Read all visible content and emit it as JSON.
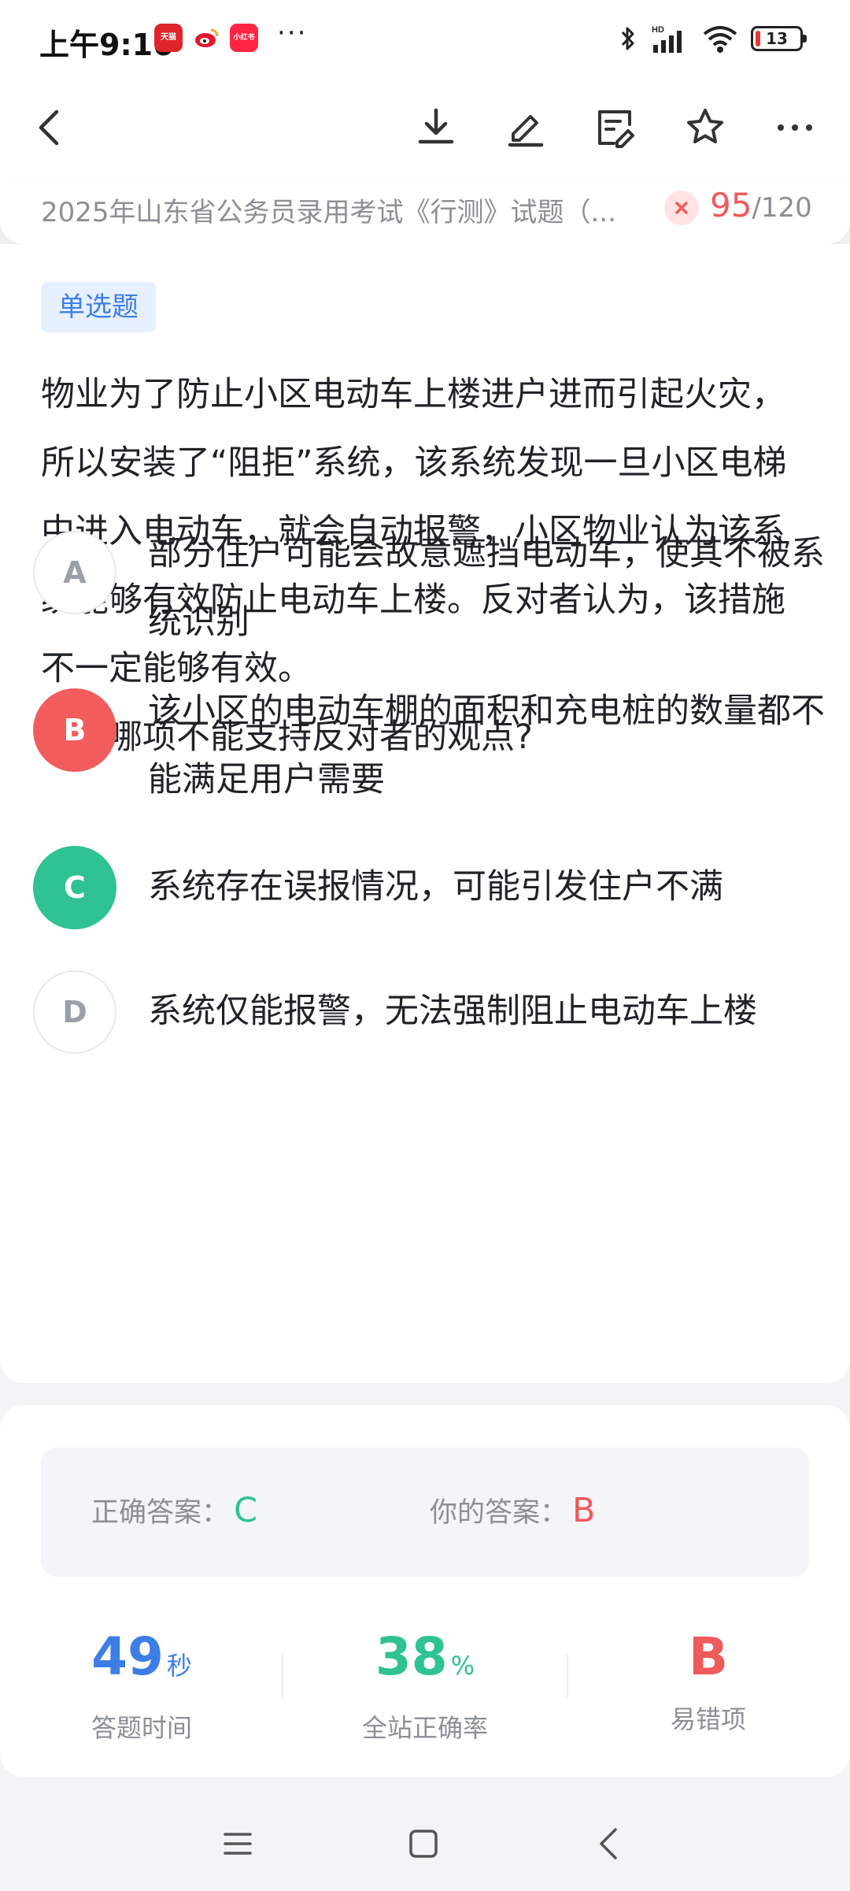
{
  "status_bar": {
    "time": "上午9:16",
    "app_badges": [
      {
        "name": "tmall",
        "text": "天猫",
        "color": "#e0242c"
      },
      {
        "name": "weibo",
        "text": "",
        "color": "#f5c518"
      },
      {
        "name": "xiaohongshu",
        "text": "小红书",
        "color": "#ff2442"
      }
    ],
    "more": "···",
    "battery_level": "13"
  },
  "toolbar": {
    "back": "back",
    "icons": [
      "download-icon",
      "edit-icon",
      "note-icon",
      "star-icon",
      "more-icon"
    ]
  },
  "exam": {
    "title": "2025年山东省公务员录用考试《行测》试题（...",
    "current": "95",
    "total": "/120",
    "status_color": "#ef5a5a"
  },
  "question": {
    "type_label": "单选题",
    "stem": "物业为了防止小区电动车上楼进户进而引起火灾，所以安装了“阻拒”系统，该系统发现一旦小区电梯中进入电动车，就会自动报警，小区物业认为该系统能够有效防止电动车上楼。反对者认为，该措施不一定能够有效。",
    "prompt": "以下哪项不能支持反对者的观点?",
    "options": [
      {
        "letter": "A",
        "text": "部分住户可能会故意遮挡电动车，使其不被系统识别",
        "state": "normal"
      },
      {
        "letter": "B",
        "text": "该小区的电动车棚的面积和充电桩的数量都不能满足用户需要",
        "state": "wrong"
      },
      {
        "letter": "C",
        "text": "系统存在误报情况，可能引发住户不满",
        "state": "correct"
      },
      {
        "letter": "D",
        "text": "系统仅能报警，无法强制阻止电动车上楼",
        "state": "normal"
      }
    ]
  },
  "answer": {
    "correct_label": "正确答案：",
    "correct_value": "C",
    "mine_label": "你的答案：",
    "mine_value": "B"
  },
  "stats": [
    {
      "value": "49",
      "unit": "秒",
      "label": "答题时间",
      "color": "#3c7ee6"
    },
    {
      "value": "38",
      "unit": "%",
      "label": "全站正确率",
      "color": "#2fc293"
    },
    {
      "value": "B",
      "unit": "",
      "label": "易错项",
      "color": "#ef5a5a"
    }
  ],
  "nav": [
    "menu",
    "home",
    "back"
  ]
}
